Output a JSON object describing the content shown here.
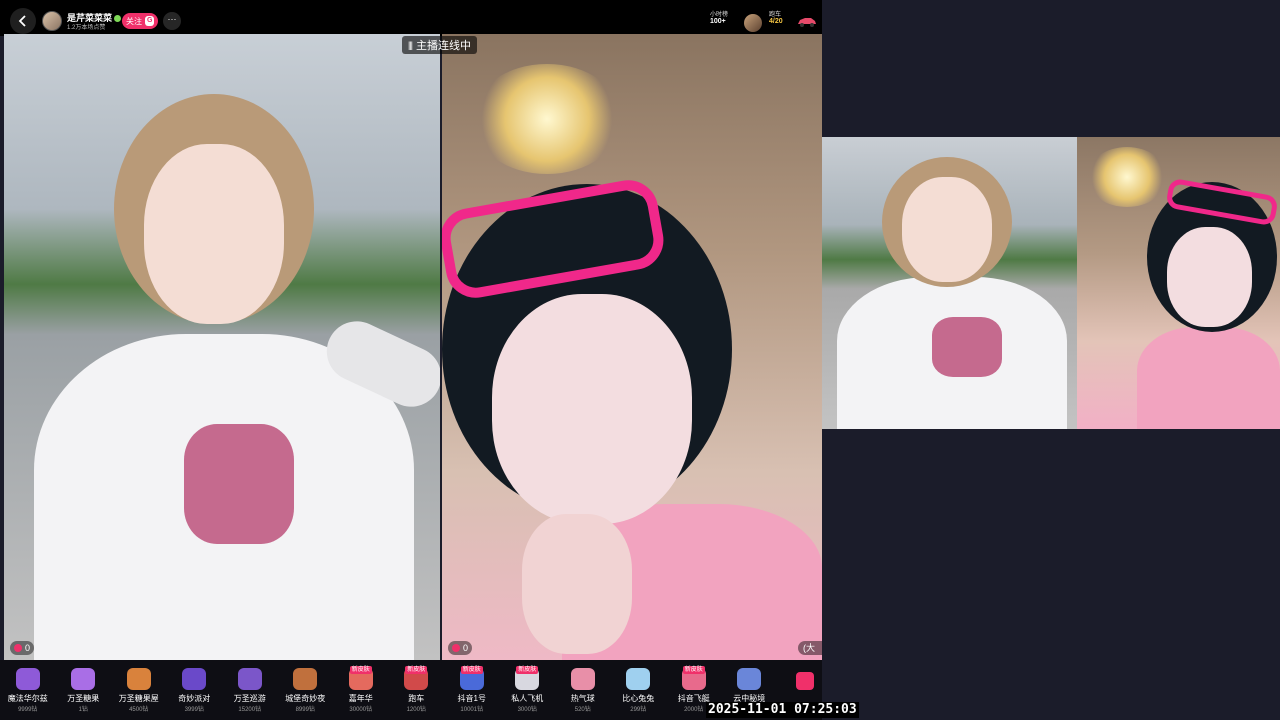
{
  "header": {
    "host_name": "是芹菜菜菜",
    "host_likes": "1.2万本场点赞",
    "follow_label": "关注",
    "follow_badge": "G",
    "more_label": "···",
    "rank_title": "小时榜",
    "rank_value": "100+",
    "car_title": "跑车",
    "car_value": "4/20"
  },
  "stage": {
    "link_status": "主播连线中",
    "left_score": "0",
    "right_score": "0",
    "more_label": "(大"
  },
  "gifts": [
    {
      "name": "魔法华尔兹",
      "price": "9999钻",
      "new": "",
      "color": "#8e5ad8"
    },
    {
      "name": "万圣糖果",
      "price": "1钻",
      "new": "",
      "color": "#a96ee6"
    },
    {
      "name": "万圣糖果屋",
      "price": "4500钻",
      "new": "",
      "color": "#d9823c"
    },
    {
      "name": "奇妙派对",
      "price": "3999钻",
      "new": "",
      "color": "#6a49c9"
    },
    {
      "name": "万圣巡游",
      "price": "15200钻",
      "new": "",
      "color": "#7b56c9"
    },
    {
      "name": "城堡奇妙夜",
      "price": "8999钻",
      "new": "",
      "color": "#c0703d"
    },
    {
      "name": "嘉年华",
      "price": "30000钻",
      "new": "新皮肤",
      "color": "#e46a5e"
    },
    {
      "name": "跑车",
      "price": "1200钻",
      "new": "新皮肤",
      "color": "#d14a4a"
    },
    {
      "name": "抖音1号",
      "price": "10001钻",
      "new": "新皮肤",
      "color": "#4a6ad9"
    },
    {
      "name": "私人飞机",
      "price": "3000钻",
      "new": "新皮肤",
      "color": "#d8d8e0"
    },
    {
      "name": "热气球",
      "price": "520钻",
      "new": "",
      "color": "#e88fa8"
    },
    {
      "name": "比心兔兔",
      "price": "299钻",
      "new": "",
      "color": "#9fd0ef"
    },
    {
      "name": "抖音飞艇",
      "price": "2000钻",
      "new": "新皮肤",
      "color": "#e86a8c"
    },
    {
      "name": "云中秘境",
      "price": "",
      "new": "",
      "color": "#6a86d9"
    }
  ],
  "gift_panel_label": "礼物",
  "timestamp": "2025-11-01  07:25:03",
  "colors": {
    "accent": "#f0306a",
    "background": "#1b1c2a",
    "gift_bar": "#0e0e14"
  }
}
